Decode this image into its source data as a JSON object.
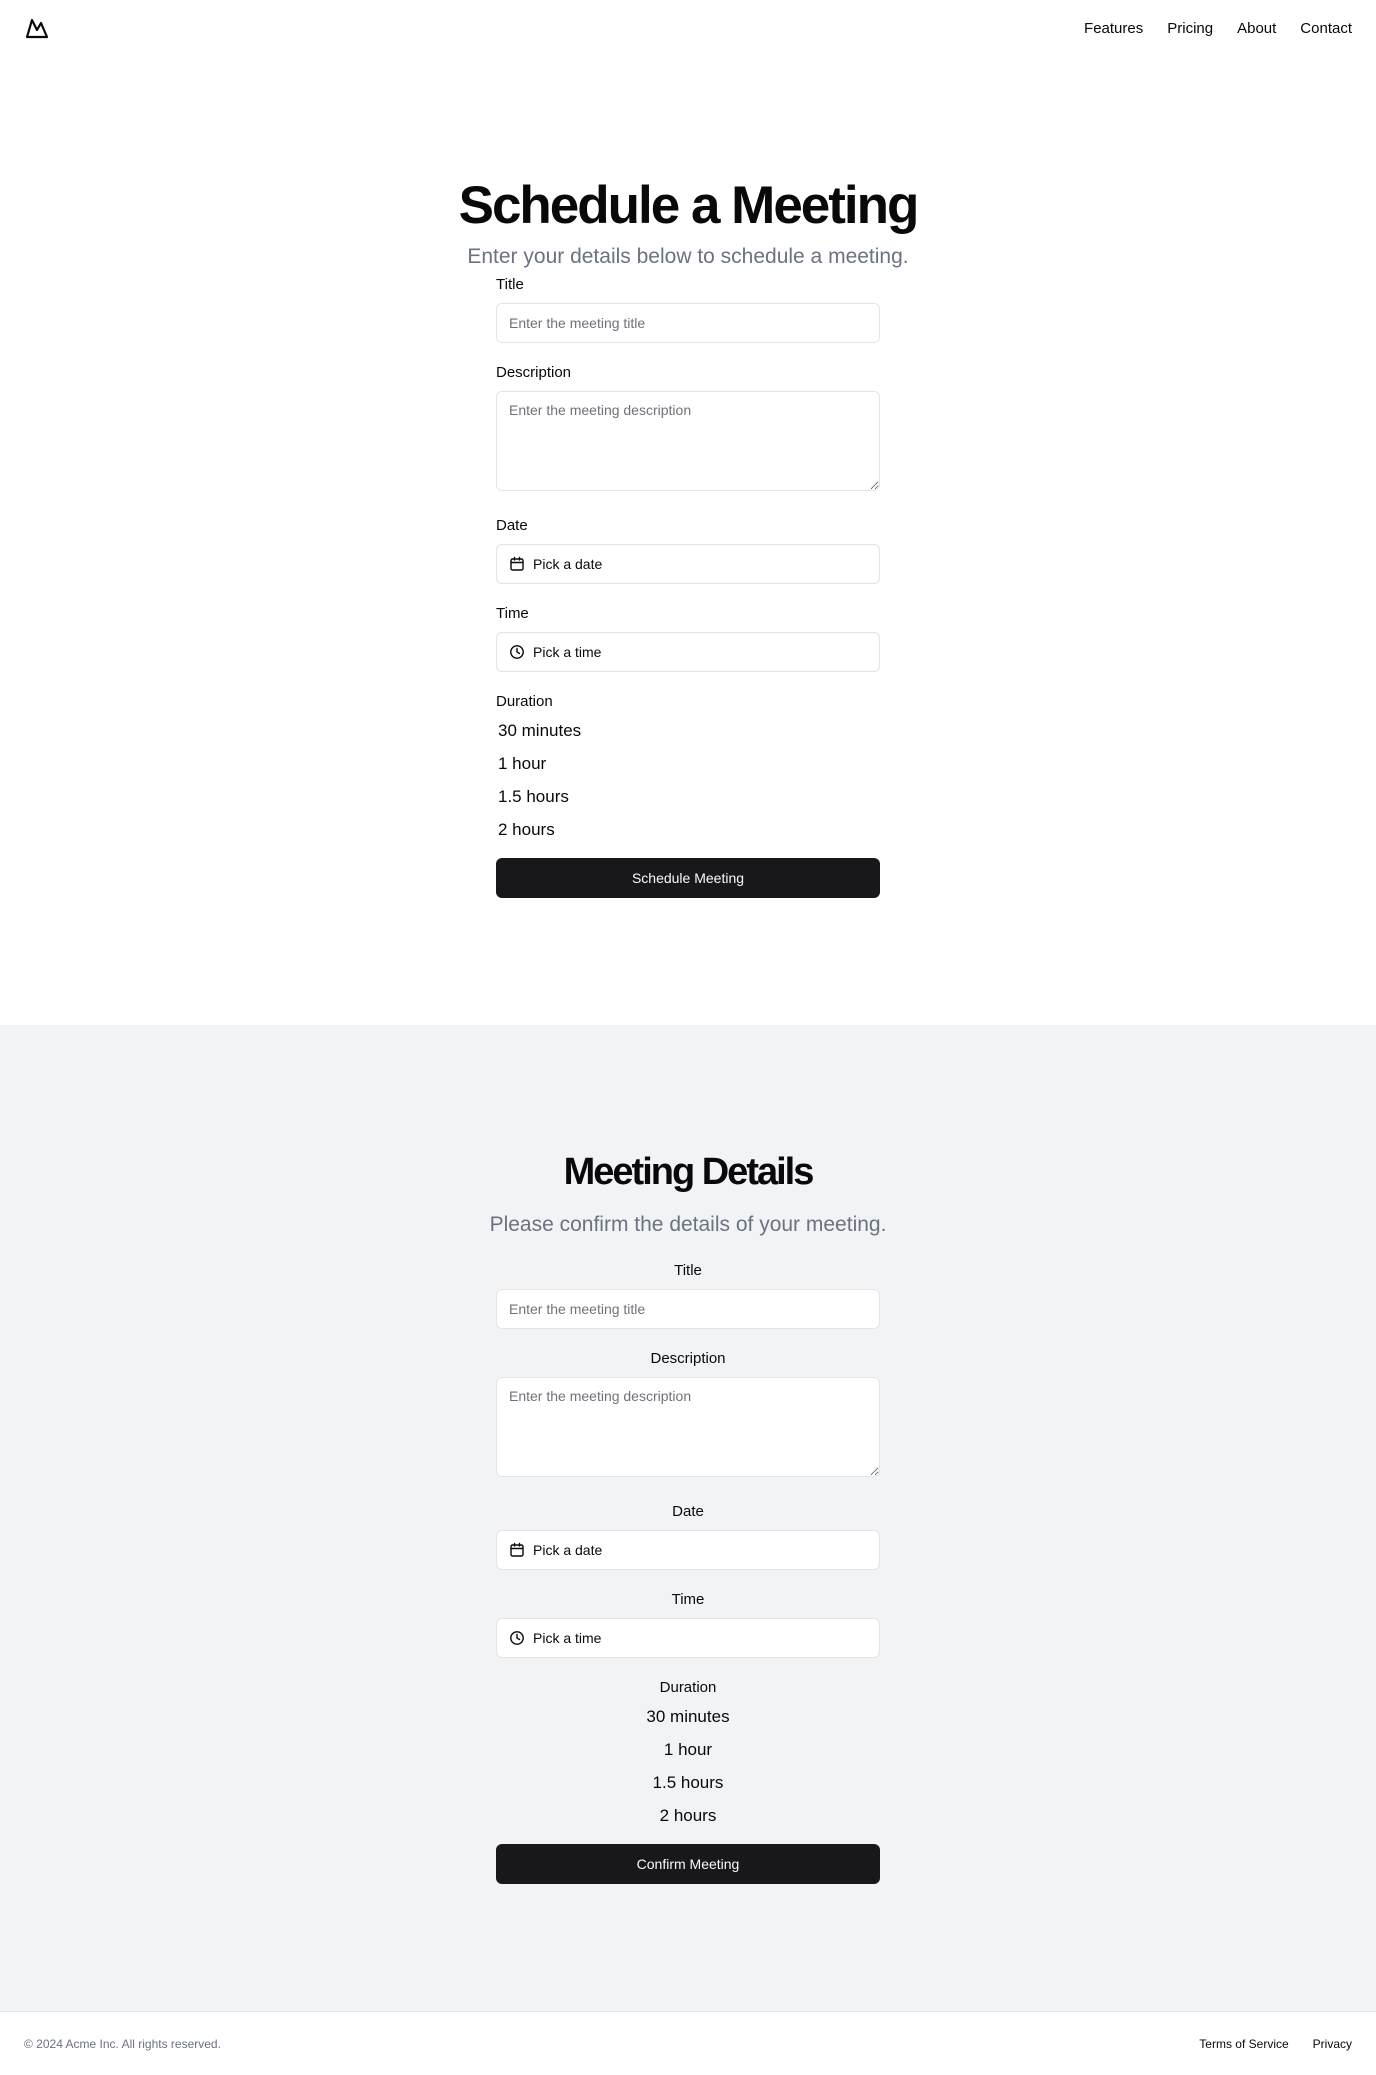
{
  "header": {
    "logo_icon": "mountain-icon",
    "nav": [
      "Features",
      "Pricing",
      "About",
      "Contact"
    ]
  },
  "schedule": {
    "title": "Schedule a Meeting",
    "subtitle": "Enter your details below to schedule a meeting.",
    "title_label": "Title",
    "title_placeholder": "Enter the meeting title",
    "description_label": "Description",
    "description_placeholder": "Enter the meeting description",
    "date_label": "Date",
    "date_picker": "Pick a date",
    "time_label": "Time",
    "time_picker": "Pick a time",
    "duration_label": "Duration",
    "durations": [
      "30 minutes",
      "1 hour",
      "1.5 hours",
      "2 hours"
    ],
    "submit": "Schedule Meeting"
  },
  "details": {
    "title": "Meeting Details",
    "subtitle": "Please confirm the details of your meeting.",
    "title_label": "Title",
    "title_placeholder": "Enter the meeting title",
    "description_label": "Description",
    "description_placeholder": "Enter the meeting description",
    "date_label": "Date",
    "date_picker": "Pick a date",
    "time_label": "Time",
    "time_picker": "Pick a time",
    "duration_label": "Duration",
    "durations": [
      "30 minutes",
      "1 hour",
      "1.5 hours",
      "2 hours"
    ],
    "submit": "Confirm Meeting"
  },
  "footer": {
    "copyright": "© 2024 Acme Inc. All rights reserved.",
    "links": [
      "Terms of Service",
      "Privacy"
    ]
  },
  "colors": {
    "primary_button": "#18181b",
    "bottom_section_bg": "#f2f3f5",
    "muted_text": "#6b7280"
  }
}
